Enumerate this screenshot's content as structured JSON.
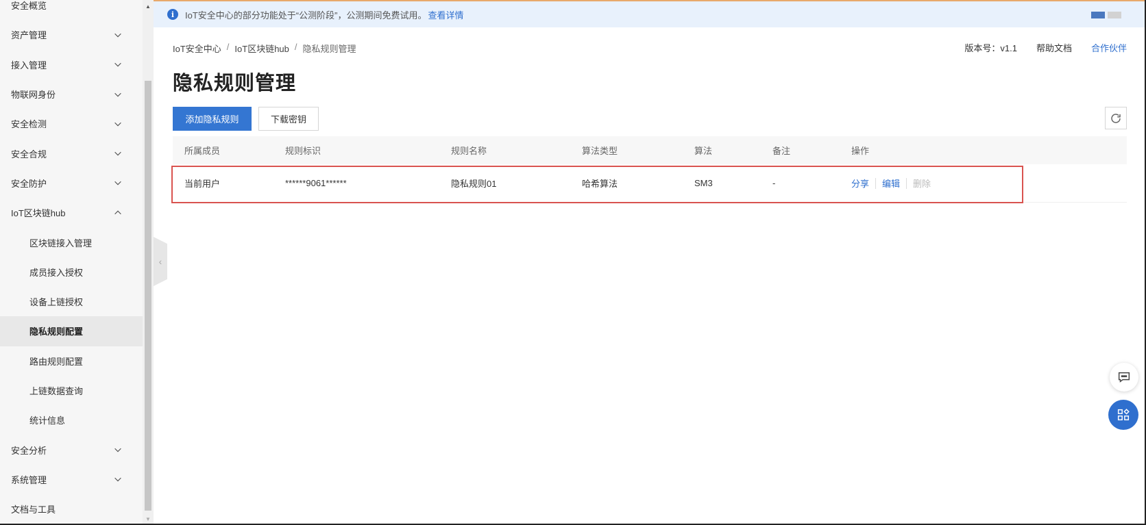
{
  "notice": {
    "text": "IoT安全中心的部分功能处于“公测阶段”，公测期间免费试用。",
    "link": "查看详情"
  },
  "sidebar": {
    "items": [
      {
        "label": "安全概览",
        "chevron": "none"
      },
      {
        "label": "资产管理",
        "chevron": "down"
      },
      {
        "label": "接入管理",
        "chevron": "down"
      },
      {
        "label": "物联网身份",
        "chevron": "down"
      },
      {
        "label": "安全检测",
        "chevron": "down"
      },
      {
        "label": "安全合规",
        "chevron": "down"
      },
      {
        "label": "安全防护",
        "chevron": "down"
      },
      {
        "label": "IoT区块链hub",
        "chevron": "up"
      }
    ],
    "subitems": [
      {
        "label": "区块链接入管理"
      },
      {
        "label": "成员接入授权"
      },
      {
        "label": "设备上链授权"
      },
      {
        "label": "隐私规则配置",
        "active": true
      },
      {
        "label": "路由规则配置"
      },
      {
        "label": "上链数据查询"
      },
      {
        "label": "统计信息"
      }
    ],
    "bottom_items": [
      {
        "label": "安全分析",
        "chevron": "down"
      },
      {
        "label": "系统管理",
        "chevron": "down"
      },
      {
        "label": "文档与工具",
        "chevron": "none"
      }
    ]
  },
  "breadcrumb": [
    "IoT安全中心",
    "IoT区块链hub",
    "隐私规则管理"
  ],
  "top_links": {
    "version": "版本号：v1.1",
    "help": "帮助文档",
    "partner": "合作伙伴"
  },
  "page_title": "隐私规则管理",
  "buttons": {
    "add": "添加隐私规则",
    "download": "下载密钥"
  },
  "table": {
    "headers": [
      "所属成员",
      "规则标识",
      "规则名称",
      "算法类型",
      "算法",
      "备注",
      "操作"
    ],
    "rows": [
      {
        "member": "当前用户",
        "rule_id": "******9061******",
        "rule_name": "隐私规则01",
        "algo_type": "哈希算法",
        "algo": "SM3",
        "note": "-",
        "ops": {
          "share": "分享",
          "edit": "编辑",
          "delete": "删除"
        }
      }
    ]
  },
  "colors": {
    "primary": "#3476d2",
    "link": "#2f6fce",
    "highlight": "#d9534f",
    "notice_bg": "#e8f1fc"
  },
  "icons": [
    "info-icon",
    "chevron-down-icon",
    "chevron-up-icon",
    "refresh-icon",
    "chat-icon",
    "apps-icon",
    "collapse-left-icon"
  ]
}
